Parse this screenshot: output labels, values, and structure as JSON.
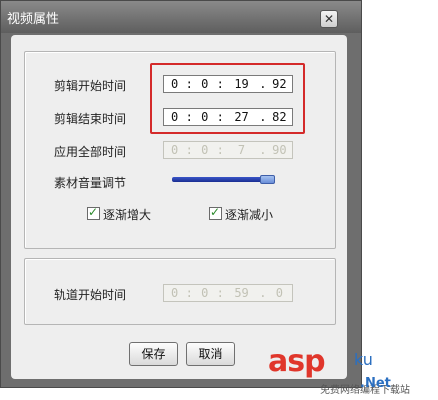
{
  "window": {
    "title": "视频属性",
    "close_glyph": "✕"
  },
  "fields": {
    "clip_start": {
      "label": "剪辑开始时间",
      "h": "0",
      "m": "0",
      "s": "19",
      "f": "92"
    },
    "clip_end": {
      "label": "剪辑结束时间",
      "h": "0",
      "m": "0",
      "s": "27",
      "f": "82"
    },
    "apply_all": {
      "label": "应用全部时间",
      "h": "0",
      "m": "0",
      "s": "7",
      "f": "90"
    },
    "track_start": {
      "label": "轨道开始时间",
      "h": "0",
      "m": "0",
      "s": "59",
      "f": "0"
    }
  },
  "separators": {
    "colon": ":",
    "dot": "."
  },
  "volume": {
    "label": "素材音量调节",
    "level": 0.95
  },
  "checkboxes": {
    "fade_in": {
      "label": "逐渐增大",
      "checked": true,
      "glyph": "✓"
    },
    "fade_out": {
      "label": "逐渐减小",
      "checked": true,
      "glyph": "✓"
    }
  },
  "buttons": {
    "save": "保存",
    "cancel": "取消"
  },
  "watermark": {
    "brand": "asp",
    "ku": "ku",
    "net": ".Net",
    "sub": "免费网络编程下载站"
  },
  "colors": {
    "highlight": "#d42a2a",
    "slider": "#1a2e92",
    "watermark_red": "#e0362b"
  }
}
